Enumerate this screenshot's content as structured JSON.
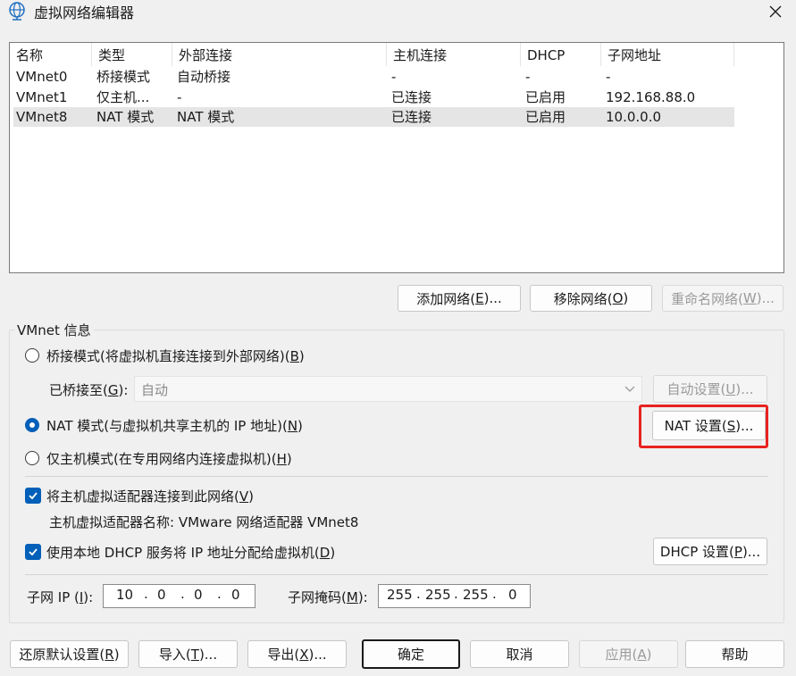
{
  "window": {
    "title": "虚拟网络编辑器",
    "icon": "globe-network-icon",
    "close_icon": "close-icon"
  },
  "list": {
    "columns": [
      "名称",
      "类型",
      "外部连接",
      "主机连接",
      "DHCP",
      "子网地址"
    ],
    "rows": [
      [
        "VMnet0",
        "桥接模式",
        "自动桥接",
        "-",
        "-",
        "-"
      ],
      [
        "VMnet1",
        "仅主机...",
        "-",
        "已连接",
        "已启用",
        "192.168.88.0"
      ],
      [
        "VMnet8",
        "NAT 模式",
        "NAT 模式",
        "已连接",
        "已启用",
        "10.0.0.0"
      ]
    ],
    "selected_row": 2
  },
  "list_buttons": {
    "add": {
      "pre": "添加网络(",
      "key": "E",
      "post": ")..."
    },
    "remove": {
      "pre": "移除网络(",
      "key": "O",
      "post": ")"
    },
    "rename": {
      "pre": "重命名网络(",
      "key": "W",
      "post": ")..."
    }
  },
  "info": {
    "group_title": "VMnet 信息",
    "bridged": {
      "pre": "桥接模式(将虚拟机直接连接到外部网络)(",
      "key": "B",
      "post": ")",
      "checked": false
    },
    "bridged_to": {
      "pre": "已桥接至(",
      "key": "G",
      "post": "):",
      "value": "自动"
    },
    "auto_settings": {
      "pre": "自动设置(",
      "key": "U",
      "post": ")..."
    },
    "nat": {
      "pre": "NAT 模式(与虚拟机共享主机的 IP 地址)(",
      "key": "N",
      "post": ")",
      "checked": true
    },
    "nat_settings": {
      "pre": "NAT 设置(",
      "key": "S",
      "post": ")..."
    },
    "hostonly": {
      "pre": "仅主机模式(在专用网络内连接虚拟机)(",
      "key": "H",
      "post": ")",
      "checked": false
    },
    "connect_adapter": {
      "pre": "将主机虚拟适配器连接到此网络(",
      "key": "V",
      "post": ")",
      "checked": true
    },
    "adapter_name": "主机虚拟适配器名称: VMware 网络适配器 VMnet8",
    "use_dhcp": {
      "pre": "使用本地 DHCP 服务将 IP 地址分配给虚拟机(",
      "key": "D",
      "post": ")",
      "checked": true
    },
    "dhcp_settings": {
      "pre": "DHCP 设置(",
      "key": "P",
      "post": ")..."
    },
    "subnet_ip": {
      "pre": "子网 IP (",
      "key": "I",
      "post": "):",
      "octets": [
        "10",
        "0",
        "0",
        "0"
      ]
    },
    "subnet_mask": {
      "pre": "子网掩码(",
      "key": "M",
      "post": "):",
      "octets": [
        "255",
        "255",
        "255",
        "0"
      ]
    }
  },
  "footer": {
    "restore": {
      "pre": "还原默认设置(",
      "key": "R",
      "post": ")"
    },
    "import": {
      "pre": "导入(",
      "key": "T",
      "post": ")..."
    },
    "export": {
      "pre": "导出(",
      "key": "X",
      "post": ")..."
    },
    "ok": "确定",
    "cancel": "取消",
    "apply": {
      "pre": "应用(",
      "key": "A",
      "post": ")"
    },
    "help": "帮助"
  },
  "colors": {
    "accent": "#005fb8",
    "highlight": "#e8231f",
    "selected_row": "#e5e5e5"
  }
}
